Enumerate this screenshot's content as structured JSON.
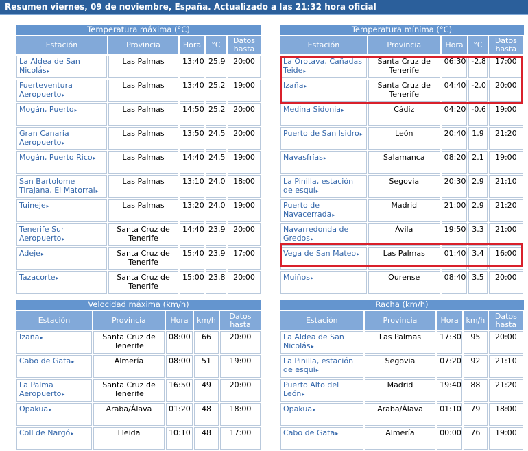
{
  "header": {
    "title": "Resumen viernes, 09 de noviembre, España. Actualizado a las 21:32 hora oficial"
  },
  "columns": {
    "station": "Estación",
    "province": "Provincia",
    "time": "Hora",
    "celsius": "°C",
    "kmh": "km/h",
    "data_until": "Datos hasta"
  },
  "arrow_icon": "triangle-right",
  "highlight_color": "#d9202b",
  "tmax": {
    "title": "Temperatura máxima (°C)",
    "rows": [
      {
        "station": "La Aldea de San Nicolás",
        "province": "Las Palmas",
        "time": "13:40",
        "value": "25.9",
        "until": "20:00"
      },
      {
        "station": "Fuerteventura Aeropuerto",
        "province": "Las Palmas",
        "time": "13:40",
        "value": "25.2",
        "until": "19:00"
      },
      {
        "station": "Mogán, Puerto",
        "province": "Las Palmas",
        "time": "14:50",
        "value": "25.2",
        "until": "20:00"
      },
      {
        "station": "Gran Canaria Aeropuerto",
        "province": "Las Palmas",
        "time": "13:50",
        "value": "24.5",
        "until": "20:00"
      },
      {
        "station": "Mogán, Puerto Rico",
        "province": "Las Palmas",
        "time": "14:40",
        "value": "24.5",
        "until": "19:00"
      },
      {
        "station": "San Bartolome Tirajana, El Matorral",
        "province": "Las Palmas",
        "time": "13:10",
        "value": "24.0",
        "until": "18:00"
      },
      {
        "station": "Tuineje",
        "province": "Las Palmas",
        "time": "13:20",
        "value": "24.0",
        "until": "19:00"
      },
      {
        "station": "Tenerife Sur Aeropuerto",
        "province": "Santa Cruz de Tenerife",
        "time": "14:40",
        "value": "23.9",
        "until": "20:00"
      },
      {
        "station": "Adeje",
        "province": "Santa Cruz de Tenerife",
        "time": "15:40",
        "value": "23.9",
        "until": "17:00"
      },
      {
        "station": "Tazacorte",
        "province": "Santa Cruz de Tenerife",
        "time": "15:00",
        "value": "23.8",
        "until": "20:00"
      }
    ]
  },
  "tmin": {
    "title": "Temperatura mínima (°C)",
    "rows": [
      {
        "station": "La Orotava, Cañadas Teide",
        "province": "Santa Cruz de Tenerife",
        "time": "06:30",
        "value": "-2.8",
        "until": "17:00"
      },
      {
        "station": "Izaña",
        "province": "Santa Cruz de Tenerife",
        "time": "04:40",
        "value": "-2.0",
        "until": "20:00"
      },
      {
        "station": "Medina Sidonia",
        "province": "Cádiz",
        "time": "04:20",
        "value": "-0.6",
        "until": "19:00"
      },
      {
        "station": "Puerto de San Isidro",
        "province": "León",
        "time": "20:40",
        "value": "1.9",
        "until": "21:20"
      },
      {
        "station": "Navasfrías",
        "province": "Salamanca",
        "time": "08:20",
        "value": "2.1",
        "until": "19:00"
      },
      {
        "station": "La Pinilla, estación de esquí",
        "province": "Segovia",
        "time": "20:30",
        "value": "2.9",
        "until": "21:10"
      },
      {
        "station": "Puerto de Navacerrada",
        "province": "Madrid",
        "time": "21:00",
        "value": "2.9",
        "until": "21:20"
      },
      {
        "station": "Navarredonda de Gredos",
        "province": "Ávila",
        "time": "19:50",
        "value": "3.3",
        "until": "21:00"
      },
      {
        "station": "Vega de San Mateo",
        "province": "Las Palmas",
        "time": "01:40",
        "value": "3.4",
        "until": "16:00"
      },
      {
        "station": "Muiños",
        "province": "Ourense",
        "time": "08:40",
        "value": "3.5",
        "until": "20:00"
      }
    ]
  },
  "vmax": {
    "title": "Velocidad máxima (km/h)",
    "rows": [
      {
        "station": "Izaña",
        "province": "Santa Cruz de Tenerife",
        "time": "08:00",
        "value": "66",
        "until": "20:00"
      },
      {
        "station": "Cabo de Gata",
        "province": "Almería",
        "time": "08:00",
        "value": "51",
        "until": "19:00"
      },
      {
        "station": "La Palma Aeropuerto",
        "province": "Santa Cruz de Tenerife",
        "time": "16:50",
        "value": "49",
        "until": "20:00"
      },
      {
        "station": "Opakua",
        "province": "Araba/Álava",
        "time": "01:20",
        "value": "48",
        "until": "18:00"
      },
      {
        "station": "Coll de Nargó",
        "province": "Lleida",
        "time": "10:10",
        "value": "48",
        "until": "17:00"
      }
    ]
  },
  "racha": {
    "title": "Racha (km/h)",
    "rows": [
      {
        "station": "La Aldea de San Nicolás",
        "province": "Las Palmas",
        "time": "17:30",
        "value": "95",
        "until": "20:00"
      },
      {
        "station": "La Pinilla, estación de esquí",
        "province": "Segovia",
        "time": "07:20",
        "value": "92",
        "until": "21:10"
      },
      {
        "station": "Puerto Alto del León",
        "province": "Madrid",
        "time": "19:40",
        "value": "88",
        "until": "21:20"
      },
      {
        "station": "Opakua",
        "province": "Araba/Álava",
        "time": "01:10",
        "value": "79",
        "until": "18:00"
      },
      {
        "station": "Cabo de Gata",
        "province": "Almería",
        "time": "00:00",
        "value": "76",
        "until": "19:00"
      }
    ]
  }
}
